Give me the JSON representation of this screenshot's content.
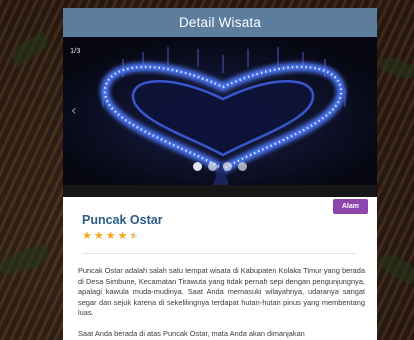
{
  "header": {
    "title": "Detail Wisata"
  },
  "gallery": {
    "counter": "1/3",
    "slide_count": 4,
    "active_index": 0
  },
  "place": {
    "category": "Alam",
    "name": "Puncak Ostar",
    "rating": 4.5,
    "rating_max": 5
  },
  "description": {
    "paragraphs": [
      "Puncak Ostar adalah salah satu tempat wisata di Kabupaten Kolaka Timur yang berada di Desa Simbune, Kecamatan Tirawuta yang tidak pernah sepi dengan pengunjungnya, apalagi kawula muda-mudinya. Saat Anda memasuki wilayahnya, udaranya sangat segar dan sejuk karena di sekelilingnya terdapat hutan-hutan pinus yang membentang luas.",
      "Saat Anda berada di atas Puncak Ostar, mata Anda akan dimanjakan"
    ]
  },
  "colors": {
    "titlebar": "#5d7d9e",
    "accent_title": "#2a5c8a",
    "badge": "#8e44ad",
    "star": "#f3a81a"
  },
  "icons": {
    "prev": "chevron-left-icon",
    "star": "star-icon"
  }
}
